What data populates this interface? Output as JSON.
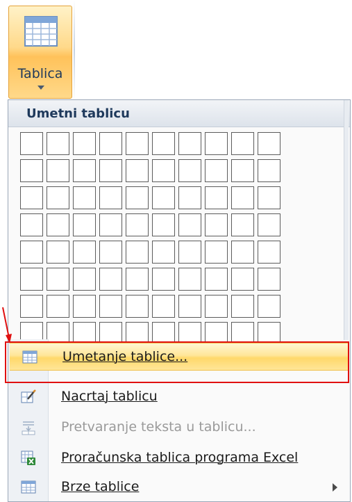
{
  "ribbon_button": {
    "label": "Tablica",
    "icon": "table-icon"
  },
  "menu": {
    "header": "Umetni tablicu",
    "grid": {
      "columns": 10,
      "rows": 8
    },
    "items": [
      {
        "label": "Umetanje tablice...",
        "icon": "insert-table-icon",
        "state": "highlighted"
      },
      {
        "label": "Nacrtaj tablicu",
        "icon": "draw-table-icon",
        "state": "normal"
      },
      {
        "label": "Pretvaranje teksta u tablicu...",
        "icon": "convert-text-icon",
        "state": "disabled"
      },
      {
        "label": "Proračunska tablica programa Excel",
        "icon": "excel-sheet-icon",
        "state": "normal"
      },
      {
        "label": "Brze tablice",
        "icon": "quick-tables-icon",
        "state": "normal",
        "submenu": true
      }
    ]
  },
  "colors": {
    "highlight": "#ffe699",
    "annotation": "#e01010",
    "header_text": "#1e395b"
  }
}
